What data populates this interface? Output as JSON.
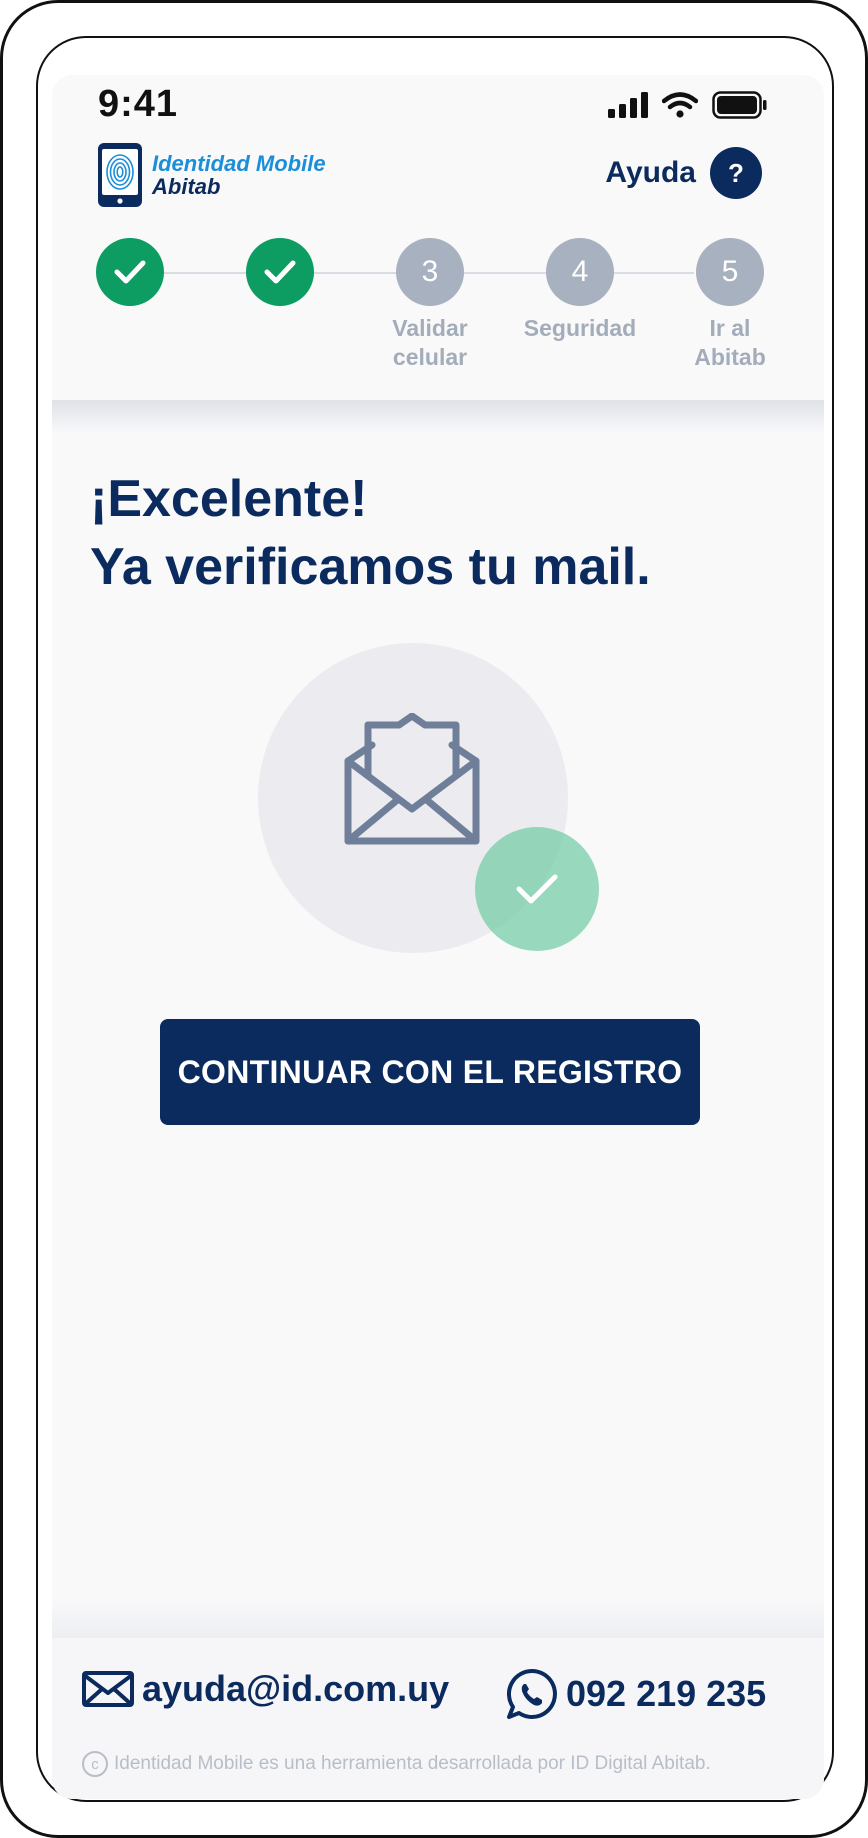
{
  "status_bar": {
    "time": "9:41",
    "icons": [
      "cellular-signal-icon",
      "wifi-icon",
      "battery-icon"
    ]
  },
  "header": {
    "logo": {
      "line1": "Identidad Mobile",
      "line2": "Abitab"
    },
    "help_label": "Ayuda",
    "help_button": "?"
  },
  "stepper": {
    "steps": [
      {
        "number": "1",
        "status": "completed",
        "label": ""
      },
      {
        "number": "2",
        "status": "completed",
        "label": ""
      },
      {
        "number": "3",
        "status": "pending",
        "label_line1": "Validar",
        "label_line2": "celular"
      },
      {
        "number": "4",
        "status": "pending",
        "label_line1": "Seguridad",
        "label_line2": ""
      },
      {
        "number": "5",
        "status": "pending",
        "label_line1": "Ir al",
        "label_line2": "Abitab"
      }
    ]
  },
  "main": {
    "title_line1": "¡Excelente!",
    "title_line2": "Ya verificamos tu mail.",
    "illustration_icons": [
      "envelope-open-icon",
      "check-icon"
    ],
    "cta_label": "CONTINUAR CON EL REGISTRO"
  },
  "footer": {
    "email": "ayuda@id.com.uy",
    "phone": "092 219 235",
    "copyright": "Identidad Mobile es una herramienta desarrollada por ID Digital Abitab."
  },
  "colors": {
    "brand_navy": "#0b2b5e",
    "brand_blue": "#1a8ed8",
    "success_green": "#0d9c62",
    "pending_gray": "#a8b1bf",
    "check_mint": "#77cda8"
  }
}
